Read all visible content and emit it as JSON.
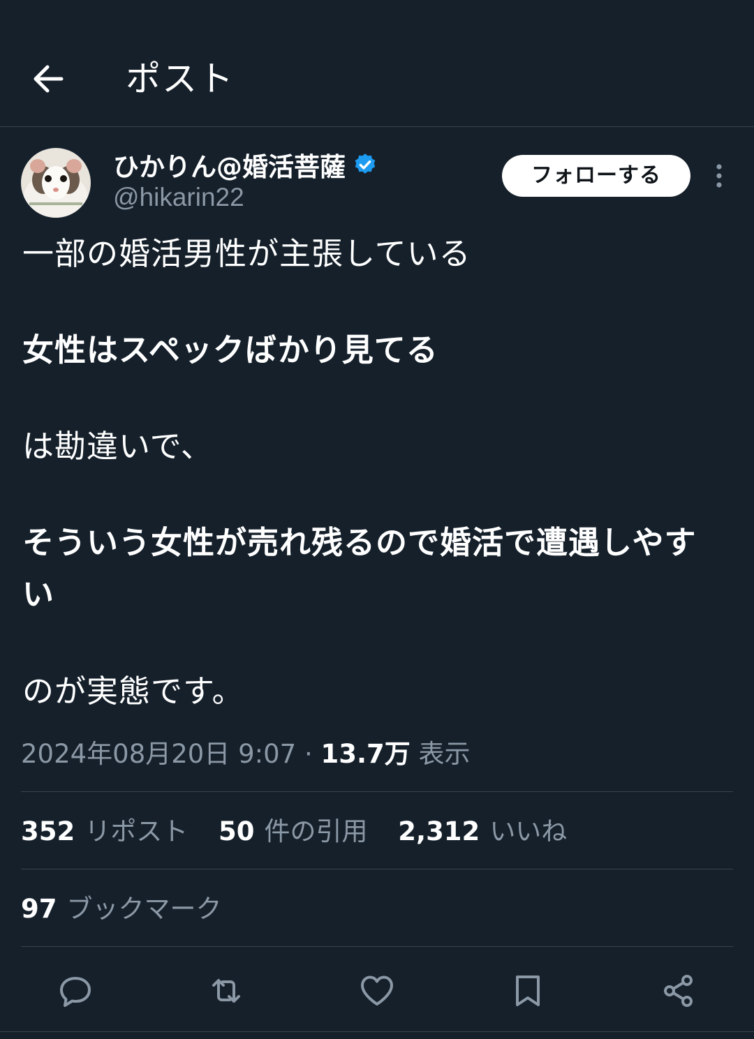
{
  "header": {
    "title": "ポスト"
  },
  "author": {
    "display_name": "ひかりん@婚活菩薩",
    "handle": "@hikarin22",
    "follow_label": "フォローする"
  },
  "tweet": {
    "lines": [
      "一部の婚活男性が主張している",
      "女性はスペックばかり見てる",
      "は勘違いで、",
      "そういう女性が売れ残るので婚活で遭遇しやす",
      "い",
      "のが実態です。"
    ]
  },
  "meta": {
    "datetime": "2024年08月20日 9:07",
    "separator": "·",
    "views_count": "13.7万",
    "views_label": "表示"
  },
  "stats": {
    "reposts_count": "352",
    "reposts_label": "リポスト",
    "quotes_count": "50",
    "quotes_label": "件の引用",
    "likes_count": "2,312",
    "likes_label": "いいね",
    "bookmarks_count": "97",
    "bookmarks_label": "ブックマーク"
  },
  "colors": {
    "background": "#15202b",
    "divider": "#38444d",
    "secondary_text": "#8b98a5",
    "verified": "#1d9bf0"
  },
  "icons": {
    "back": "arrow-left-icon",
    "verified": "verified-badge-icon",
    "more": "more-vertical-icon",
    "reply": "reply-icon",
    "repost": "repost-icon",
    "like": "heart-icon",
    "bookmark": "bookmark-icon",
    "share": "share-icon"
  }
}
